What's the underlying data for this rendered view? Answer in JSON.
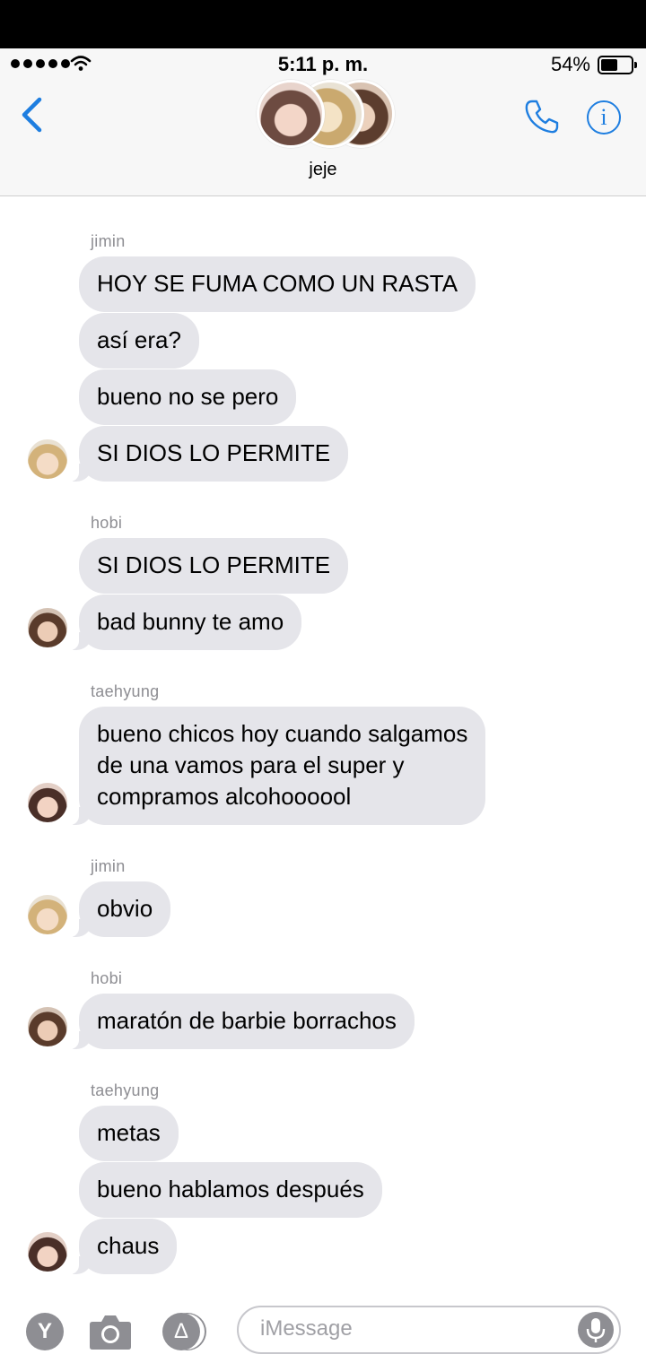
{
  "status_bar": {
    "time": "5:11 p. m.",
    "battery": "54%"
  },
  "header": {
    "group_name": "jeje"
  },
  "messages": [
    {
      "sender": "jimin",
      "lines": [
        "HOY SE FUMA COMO UN RASTA",
        "así era?",
        "bueno no se pero",
        "SI DIOS LO PERMITE"
      ]
    },
    {
      "sender": "hobi",
      "lines": [
        "SI DIOS LO PERMITE",
        "bad bunny te amo"
      ]
    },
    {
      "sender": "taehyung",
      "lines": [
        "bueno chicos hoy cuando salgamos\nde una vamos para el super y\ncompramos alcohoooool"
      ]
    },
    {
      "sender": "jimin",
      "lines": [
        "obvio"
      ]
    },
    {
      "sender": "hobi",
      "lines": [
        "maratón de barbie borrachos"
      ]
    },
    {
      "sender": "taehyung",
      "lines": [
        "metas",
        "bueno hablamos después",
        "chaus"
      ]
    }
  ],
  "input": {
    "placeholder": "iMessage",
    "app_icon_letter": "Y"
  },
  "icons": [
    "back-chevron-icon",
    "phone-icon",
    "info-icon",
    "camera-icon",
    "app-store-icon",
    "microphone-icon"
  ],
  "colors": {
    "accent": "#1e7ee0",
    "bubble": "#e5e5ea",
    "sender_label": "#8e8e93"
  }
}
